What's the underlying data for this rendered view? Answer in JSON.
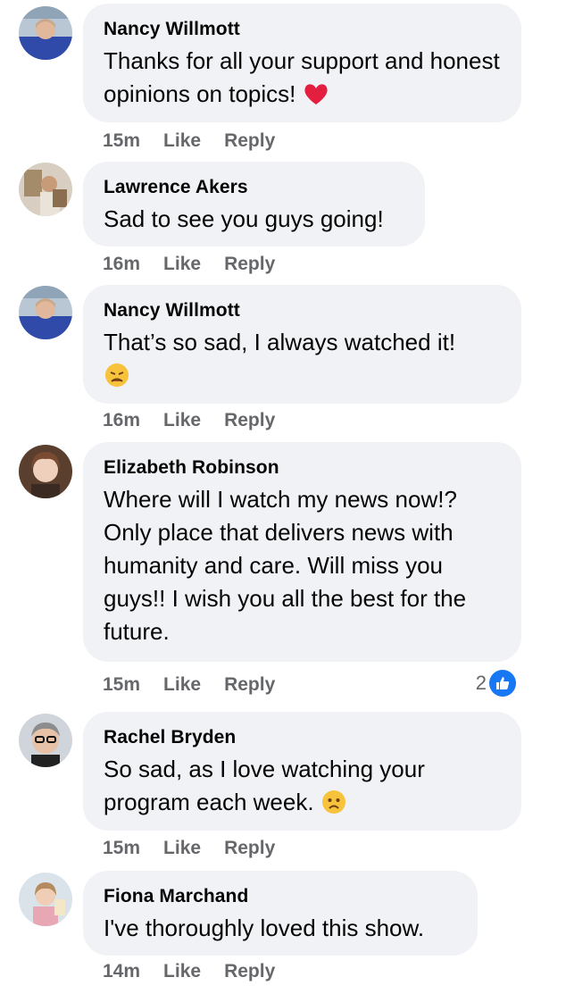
{
  "colors": {
    "bubble_bg": "#f0f2f5",
    "meta_text": "#65676b",
    "like_blue": "#1877f2",
    "heart_red": "#e41e3f"
  },
  "comments": [
    {
      "author": "Nancy Willmott",
      "text": "Thanks for all your support and honest opinions on topics!",
      "emoji": "red-heart-emoji",
      "time": "15m",
      "like_label": "Like",
      "reply_label": "Reply"
    },
    {
      "author": "Lawrence Akers",
      "text": "Sad to see you guys going!",
      "time": "16m",
      "like_label": "Like",
      "reply_label": "Reply"
    },
    {
      "author": "Nancy Willmott",
      "text": "That’s so sad, I always watched it!",
      "emoji": "weary-face-emoji",
      "time": "16m",
      "like_label": "Like",
      "reply_label": "Reply"
    },
    {
      "author": "Elizabeth Robinson",
      "text": "Where will I watch my news now!? Only place that delivers news with humanity and care. Will miss you guys!! I wish you all the best for the future.",
      "time": "15m",
      "like_label": "Like",
      "reply_label": "Reply",
      "reaction_count": "2",
      "reaction_icon": "like-reaction-icon"
    },
    {
      "author": "Rachel Bryden",
      "text": "So sad, as I love watching your program each week.",
      "emoji": "sad-face-emoji",
      "time": "15m",
      "like_label": "Like",
      "reply_label": "Reply"
    },
    {
      "author": "Fiona Marchand",
      "text": "I've thoroughly loved this show.",
      "time": "14m",
      "like_label": "Like",
      "reply_label": "Reply"
    }
  ]
}
